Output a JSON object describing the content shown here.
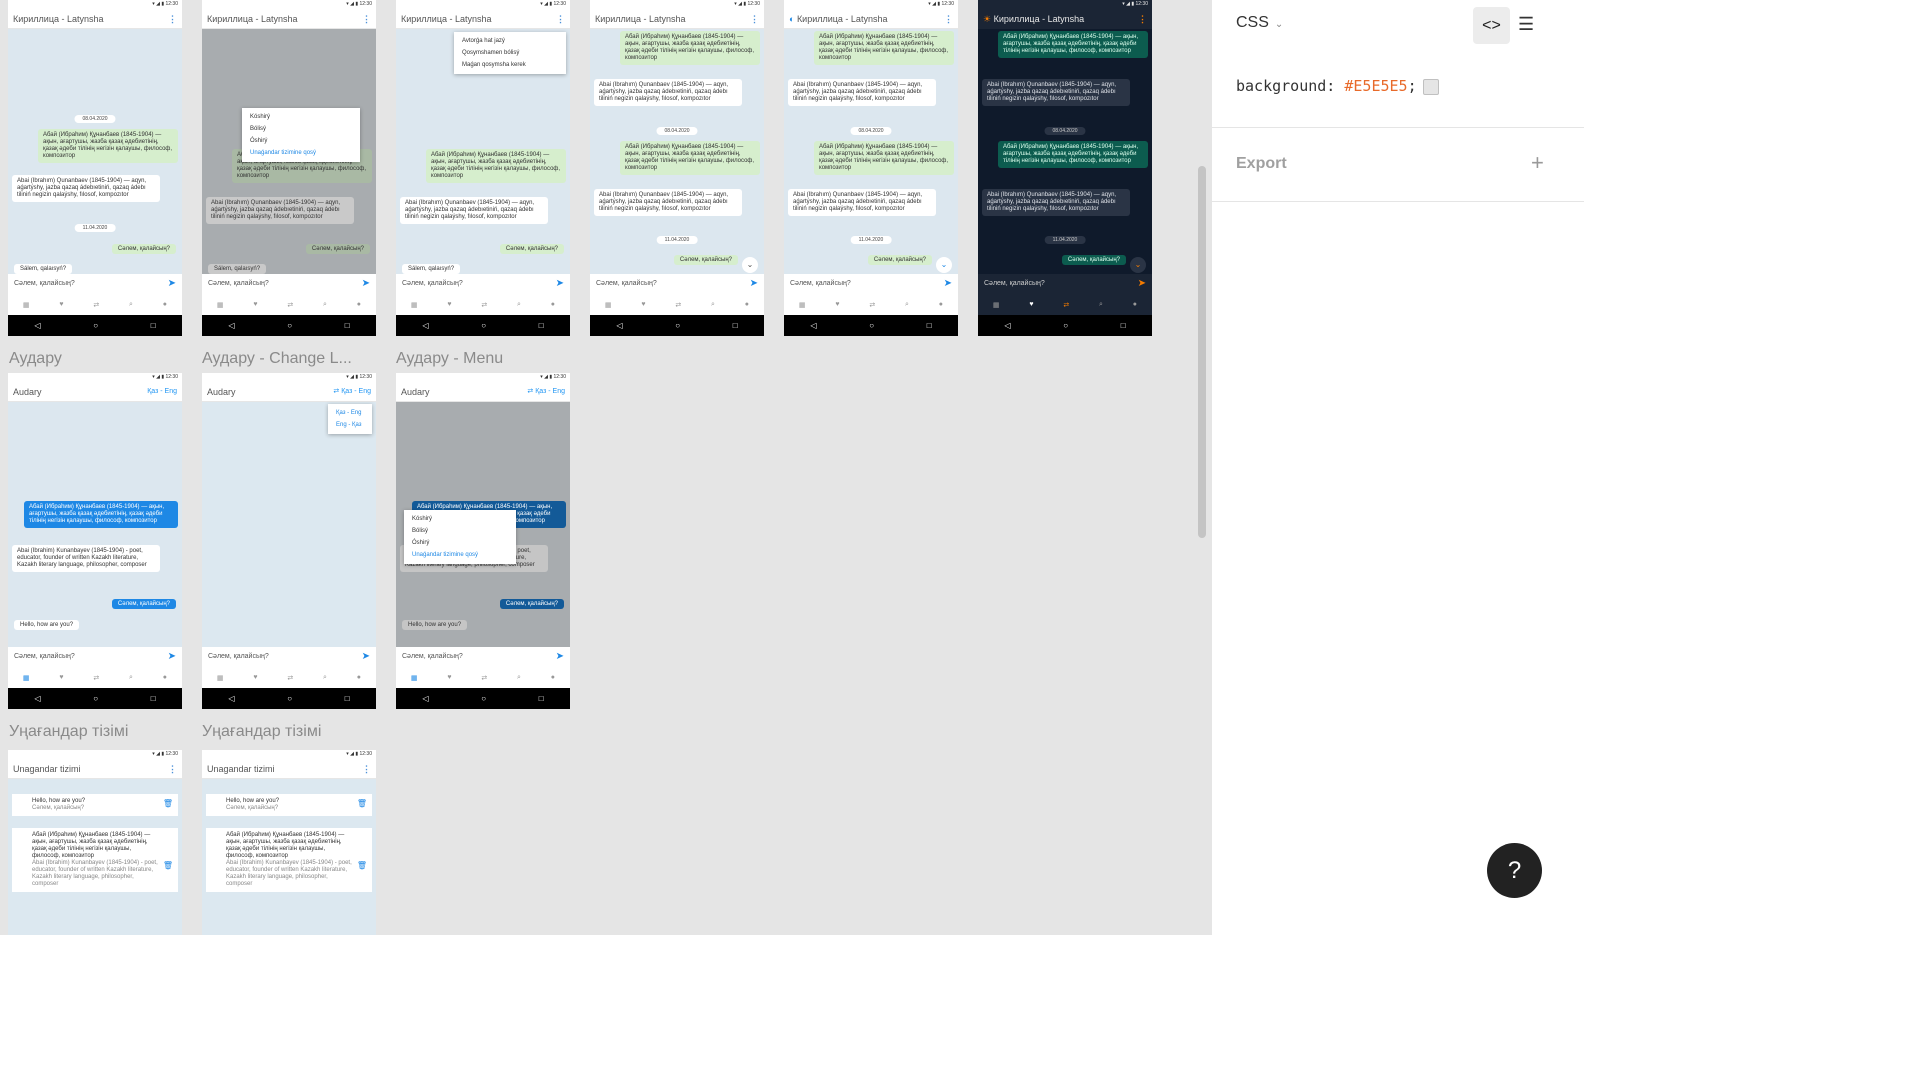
{
  "canvas": {
    "background": "#E5E5E5",
    "labels": {
      "row1_a": "Аудару",
      "row1_b": "Аудару - Change L...",
      "row1_c": "Аудару - Menu",
      "row2_a": "Уңағандар тізімі",
      "row2_b": "Уңағандар тізімі"
    },
    "phones": {
      "title_cyr_lat": "Кириллица - Latynsha",
      "title_audary": "Audary",
      "title_unagandar": "Unagandar tizimi",
      "lang_pair": "Қаз - Eng",
      "lang_opt_1": "Қаз - Eng",
      "lang_opt_2": "Eng - Қаз",
      "date_1": "08.04.2020",
      "date_2": "11.04.2020",
      "msg_cyr": "Абай (Ибраһим) Құнанбаев (1845-1904) — ақын, ағартушы, жазба қазақ әдебиетінің, қазақ әдеби тілінің негізін қалаушы, философ, композитор",
      "msg_lat": "Abai (Ibrahım) Qunanbaev (1845-1904) — aqyn, aǵartýshy, jazba qazaq ádebıetiniń, qazaq ádebı tiliniń negizin qalaýshy, fılosof, kompozıtor",
      "msg_en": "Abai (Ibrahim) Kunanbayev (1845-1904) - poet, educator, founder of written Kazakh literature, Kazakh literary language, philosopher, composer",
      "reply_cyr": "Сәлем, қалайсың?",
      "reply_lat": "Sálem, qalaısyń?",
      "reply_en": "Hello, how are you?",
      "input_placeholder": "Сәлем, қалайсың?",
      "menu_copy": "Kóshirý",
      "menu_share": "Bólisý",
      "menu_delete": "Óshirý",
      "menu_fav": "Unaǵandar tizimine qosý",
      "menu_top_1": "Avtorǵa hat jazý",
      "menu_top_2": "Qosymshamen bólisý",
      "menu_top_3": "Maǵan qosymsha kerek",
      "send_icon": "➤",
      "dots_icon": "⋮"
    }
  },
  "panel": {
    "mode": "CSS",
    "css_property": "background:",
    "css_value": "#E5E5E5",
    "css_semicolon": ";",
    "export_label": "Export",
    "help_label": "?"
  }
}
